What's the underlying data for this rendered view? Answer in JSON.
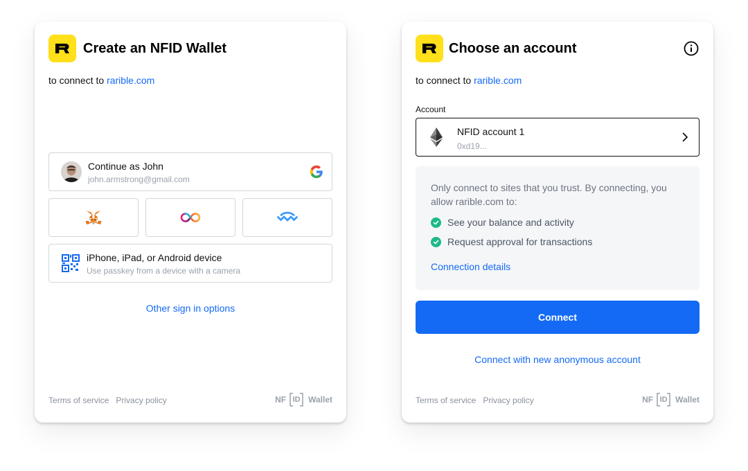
{
  "left_card": {
    "title": "Create an NFID Wallet",
    "subtitle_prefix": "to connect to ",
    "subtitle_link": "rarible.com",
    "google_option": {
      "name": "Continue as John",
      "email": "john.armstrong@gmail.com",
      "icon": "google-icon"
    },
    "wallet_buttons": [
      {
        "icon": "metamask-icon"
      },
      {
        "icon": "internet-identity-icon"
      },
      {
        "icon": "walletconnect-icon"
      }
    ],
    "passkey_option": {
      "title": "iPhone, iPad, or Android device",
      "subtitle": "Use passkey from a device with a camera",
      "icon": "qr-code-icon"
    },
    "other_options_link": "Other sign in options",
    "footer": {
      "terms": "Terms of service",
      "privacy": "Privacy policy",
      "brand_nf": "NF",
      "brand_id": "ID",
      "brand_wallet": "Wallet"
    }
  },
  "right_card": {
    "title": "Choose an account",
    "subtitle_prefix": "to connect to ",
    "subtitle_link": "rarible.com",
    "account_label": "Account",
    "account": {
      "name": "NFID account 1",
      "address": "0xd19...",
      "icon": "ethereum-icon"
    },
    "trust_text": "Only connect to sites that you trust. By connecting, you allow rarible.com to:",
    "permissions": [
      "See your balance and activity",
      "Request approval for transactions"
    ],
    "connection_details_link": "Connection details",
    "connect_button": "Connect",
    "anon_link": "Connect with new anonymous account",
    "footer": {
      "terms": "Terms of service",
      "privacy": "Privacy policy",
      "brand_nf": "NF",
      "brand_id": "ID",
      "brand_wallet": "Wallet"
    }
  },
  "colors": {
    "accent": "#146AF5",
    "logo_bg": "#FFE01B",
    "check": "#1DB98A",
    "muted": "#9aa1ab"
  }
}
